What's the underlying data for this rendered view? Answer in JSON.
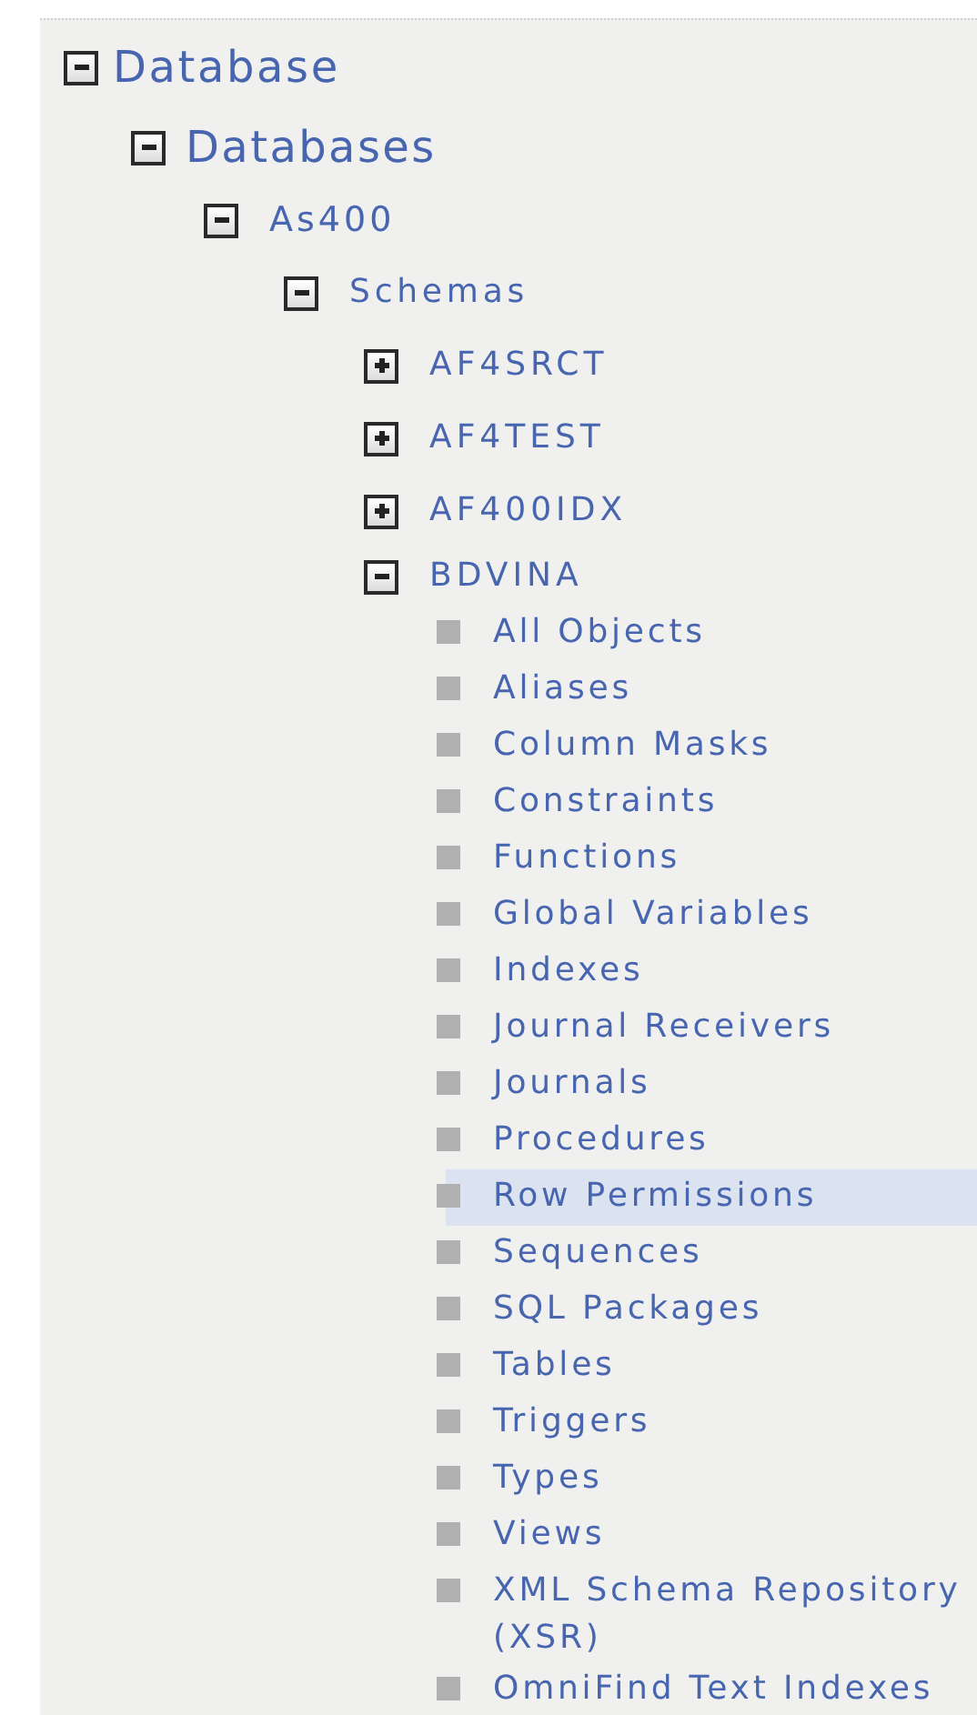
{
  "tree": [
    {
      "label": "Database",
      "kind": "branch",
      "expanded": true,
      "children": [
        {
          "label": "Databases",
          "kind": "branch",
          "expanded": true,
          "children": [
            {
              "label": "As400",
              "kind": "branch",
              "expanded": true,
              "children": [
                {
                  "label": "Schemas",
                  "kind": "branch",
                  "expanded": true,
                  "children": [
                    {
                      "label": "AF4SRCT",
                      "kind": "branch",
                      "expanded": false
                    },
                    {
                      "label": "AF4TEST",
                      "kind": "branch",
                      "expanded": false
                    },
                    {
                      "label": "AF400IDX",
                      "kind": "branch",
                      "expanded": false
                    },
                    {
                      "label": "BDVINA",
                      "kind": "branch",
                      "expanded": true,
                      "children": [
                        {
                          "label": "All Objects",
                          "kind": "leaf",
                          "selected": false
                        },
                        {
                          "label": "Aliases",
                          "kind": "leaf",
                          "selected": false
                        },
                        {
                          "label": "Column Masks",
                          "kind": "leaf",
                          "selected": false
                        },
                        {
                          "label": "Constraints",
                          "kind": "leaf",
                          "selected": false
                        },
                        {
                          "label": "Functions",
                          "kind": "leaf",
                          "selected": false
                        },
                        {
                          "label": "Global Variables",
                          "kind": "leaf",
                          "selected": false
                        },
                        {
                          "label": "Indexes",
                          "kind": "leaf",
                          "selected": false
                        },
                        {
                          "label": "Journal Receivers",
                          "kind": "leaf",
                          "selected": false
                        },
                        {
                          "label": "Journals",
                          "kind": "leaf",
                          "selected": false
                        },
                        {
                          "label": "Procedures",
                          "kind": "leaf",
                          "selected": false
                        },
                        {
                          "label": "Row Permissions",
                          "kind": "leaf",
                          "selected": true
                        },
                        {
                          "label": "Sequences",
                          "kind": "leaf",
                          "selected": false
                        },
                        {
                          "label": "SQL Packages",
                          "kind": "leaf",
                          "selected": false
                        },
                        {
                          "label": "Tables",
                          "kind": "leaf",
                          "selected": false
                        },
                        {
                          "label": "Triggers",
                          "kind": "leaf",
                          "selected": false
                        },
                        {
                          "label": "Types",
                          "kind": "leaf",
                          "selected": false
                        },
                        {
                          "label": "Views",
                          "kind": "leaf",
                          "selected": false
                        },
                        {
                          "label": "XML Schema Repository (XSR)",
                          "kind": "leaf",
                          "selected": false
                        },
                        {
                          "label": "OmniFind Text Indexes",
                          "kind": "leaf",
                          "selected": false
                        }
                      ]
                    }
                  ]
                }
              ]
            }
          ]
        }
      ]
    }
  ]
}
